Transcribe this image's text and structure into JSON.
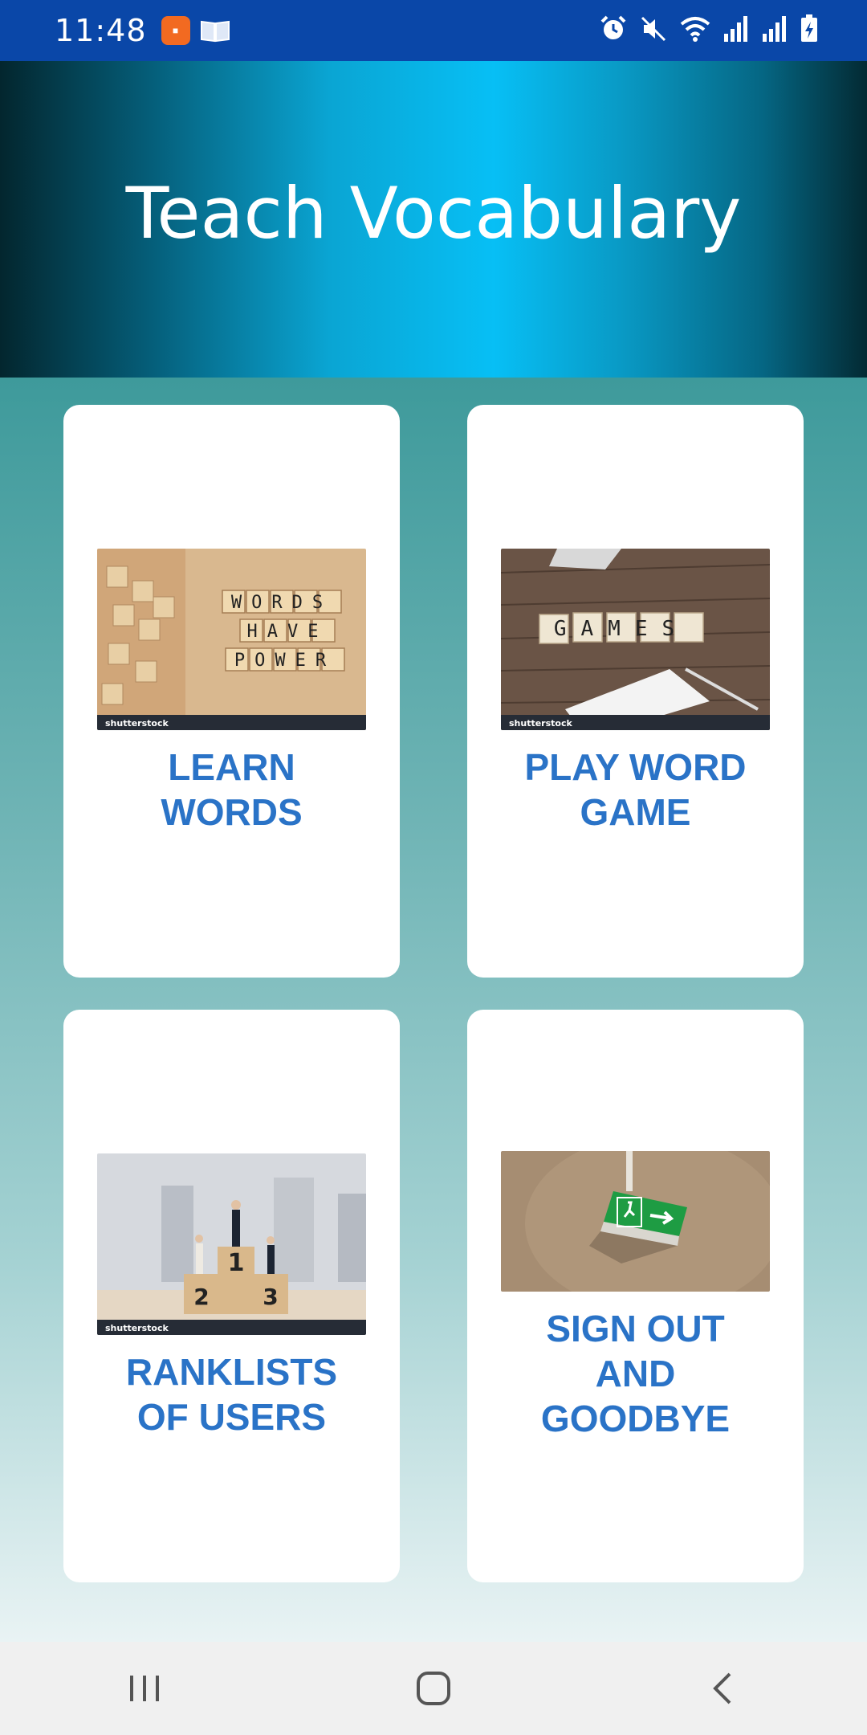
{
  "status_bar": {
    "time": "11:48",
    "notification_icons": [
      "app-notification-icon",
      "book-icon"
    ],
    "system_icons": [
      "alarm-icon",
      "mute-icon",
      "wifi-icon",
      "signal-icon",
      "signal-icon",
      "battery-charging-icon"
    ]
  },
  "header": {
    "title": "Teach Vocabulary"
  },
  "menu": {
    "learn_words": "LEARN\nWORDS",
    "play_word_game": "PLAY WORD\nGAME",
    "ranklists": "RANKLISTS\nOF USERS",
    "sign_out": "SIGN OUT\nAND\nGOODBYE"
  },
  "images": {
    "learn_tiles": [
      "WORDS",
      "HAVE",
      "POWER"
    ],
    "games_tiles": "GAMES",
    "watermark": "shutterstock",
    "podium_places": [
      "1",
      "2",
      "3"
    ]
  },
  "nav_bar": {
    "buttons": [
      "recent-apps-icon",
      "home-icon",
      "back-icon"
    ]
  },
  "colors": {
    "status_bar": "#0a47a8",
    "label_blue": "#2a73c7",
    "card": "#ffffff"
  }
}
